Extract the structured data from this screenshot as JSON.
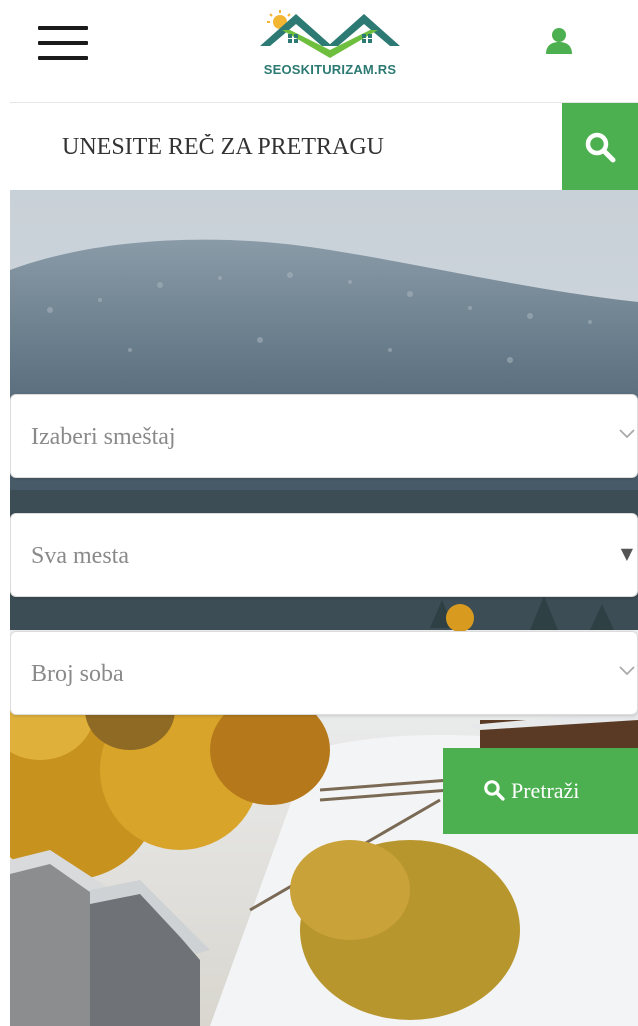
{
  "header": {
    "menu_icon": "hamburger-menu-icon",
    "logo_text": "SEOSKITURIZAM.RS",
    "user_icon": "user-icon"
  },
  "search": {
    "placeholder": "UNESITE REČ ZA PRETRAGU",
    "value": "",
    "button_icon": "search-icon"
  },
  "filters": {
    "accommodation": {
      "selected": "Izaberi smeštaj",
      "indicator": "chevron-down-icon"
    },
    "places": {
      "selected": "Sva mesta",
      "indicator": "▼"
    },
    "rooms": {
      "selected": "Broj soba",
      "indicator": "chevron-down-icon"
    }
  },
  "submit": {
    "label": "Pretraži",
    "icon": "search-icon"
  },
  "colors": {
    "accent_green": "#4caf50",
    "logo_teal": "#2c7a73"
  }
}
